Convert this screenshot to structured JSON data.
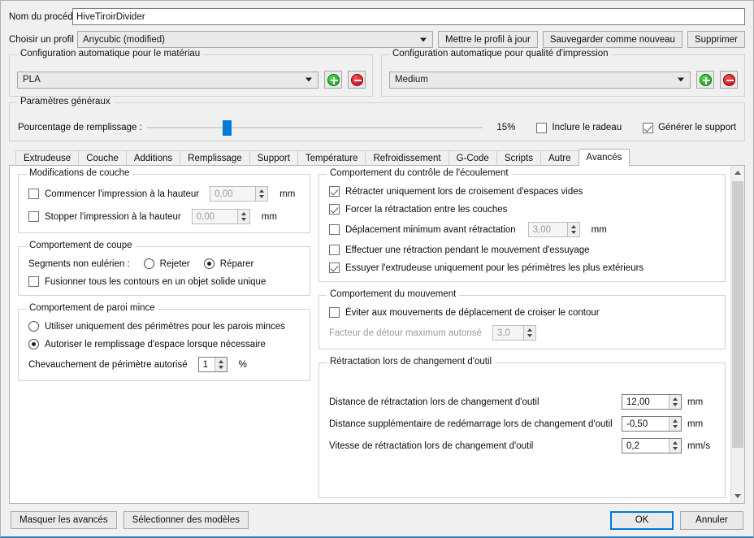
{
  "header": {
    "name_label": "Nom du procédé :",
    "name_value": "HiveTiroirDivider",
    "profile_label": "Choisir un profil :",
    "profile_value": "Anycubic (modified)",
    "update_profile_button": "Mettre le profil à jour",
    "save_as_new_button": "Sauvegarder comme nouveau",
    "delete_button": "Supprimer"
  },
  "auto_material": {
    "title": "Configuration automatique pour le matériau",
    "value": "PLA",
    "add_button": "+",
    "remove_button": "-"
  },
  "auto_quality": {
    "title": "Configuration automatique pour qualité d'impression",
    "value": "Medium",
    "add_button": "+",
    "remove_button": "-"
  },
  "general": {
    "title": "Paramètres généraux",
    "infill_label": "Pourcentage de remplissage :",
    "infill_value": "15%",
    "infill_percent": 15,
    "raft_label": "Inclure le radeau",
    "raft_checked": false,
    "support_label": "Générer le support",
    "support_checked": true
  },
  "tabs": [
    {
      "label": "Extrudeuse",
      "active": false
    },
    {
      "label": "Couche",
      "active": false
    },
    {
      "label": "Additions",
      "active": false
    },
    {
      "label": "Remplissage",
      "active": false
    },
    {
      "label": "Support",
      "active": false
    },
    {
      "label": "Température",
      "active": false
    },
    {
      "label": "Refroidissement",
      "active": false
    },
    {
      "label": "G-Code",
      "active": false
    },
    {
      "label": "Scripts",
      "active": false
    },
    {
      "label": "Autre",
      "active": false
    },
    {
      "label": "Avancés",
      "active": true
    }
  ],
  "layer_modifications": {
    "title": "Modifications de couche",
    "start_label": "Commencer l'impression à la hauteur",
    "start_checked": false,
    "start_value": "0,00",
    "start_unit": "mm",
    "stop_label": "Stopper  l'impression à la hauteur",
    "stop_checked": false,
    "stop_value": "0,00",
    "stop_unit": "mm"
  },
  "cut_behavior": {
    "title": "Comportement de coupe",
    "segments_label": "Segments non eulérien :",
    "reject_label": "Rejeter",
    "reject_selected": false,
    "repair_label": "Réparer",
    "repair_selected": true,
    "merge_label": "Fusionner tous les contours en un objet solide unique",
    "merge_checked": false
  },
  "thin_wall": {
    "title": "Comportement de paroi mince",
    "perimeters_only_label": "Utiliser uniquement des périmètres pour les parois minces",
    "perimeters_only_selected": false,
    "allow_gap_fill_label": "Autoriser le remplissage d'espace lorsque nécessaire",
    "allow_gap_fill_selected": true,
    "overlap_label": "Chevauchement de périmètre autorisé",
    "overlap_value": "1",
    "overlap_unit": "%"
  },
  "flow_control": {
    "title": "Comportement du contrôle de l'écoulement",
    "items": [
      {
        "label": "Rétracter uniquement lors de croisement d'espaces vides",
        "checked": true
      },
      {
        "label": "Forcer la rétractation entre les couches",
        "checked": true
      },
      {
        "label": "Déplacement minimum avant rétractation",
        "checked": false,
        "value": "3,00",
        "unit": "mm",
        "disabled": true
      },
      {
        "label": "Effectuer une rétraction pendant le mouvement d'essuyage",
        "checked": false
      },
      {
        "label": "Essuyer l'extrudeuse uniquement pour les périmètres les plus extérieurs",
        "checked": true
      }
    ]
  },
  "movement": {
    "title": "Comportement du mouvement",
    "avoid_label": "Éviter aux mouvements de déplacement de croiser le contour",
    "avoid_checked": false,
    "detour_label": "Facteur de détour maximum autorisé",
    "detour_value": "3,0",
    "detour_disabled": true
  },
  "tool_change": {
    "title": "Rétractation lors de changement d'outil",
    "rows": [
      {
        "label": "Distance de rétractation lors de changement d'outil",
        "value": "12,00",
        "unit": "mm"
      },
      {
        "label": "Distance supplémentaire de redémarrage lors de changement d'outil",
        "value": "-0,50",
        "unit": "mm"
      },
      {
        "label": "Vitesse de rétractation lors de changement d'outil",
        "value": "0,2",
        "unit": "mm/s"
      }
    ]
  },
  "footer": {
    "hide_advanced_button": "Masquer les avancés",
    "select_models_button": "Sélectionner des modèles",
    "ok_button": "OK",
    "cancel_button": "Annuler"
  },
  "colors": {
    "accent": "#0078d7",
    "slider": "#007ad9",
    "add": "#0f9c17",
    "remove": "#c00014"
  }
}
